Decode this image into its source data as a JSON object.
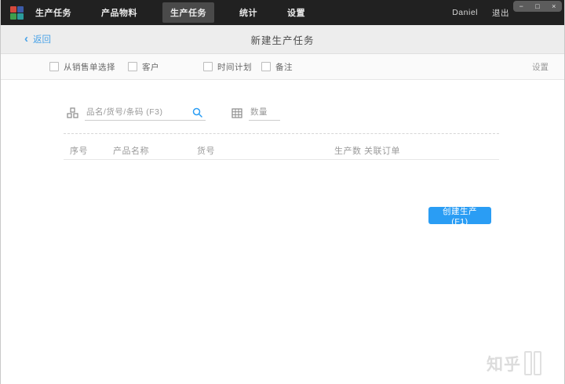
{
  "window": {
    "controls": {
      "minimize": "−",
      "maximize": "□",
      "close": "×"
    }
  },
  "titlebar": {
    "logo_colors": [
      "#d5493c",
      "#3c5ba8",
      "#3f9e4d",
      "#2b9c9c"
    ],
    "menu": [
      {
        "label": "生产任务"
      },
      {
        "label": "产品物料"
      },
      {
        "label": "生产任务"
      },
      {
        "label": "统计"
      },
      {
        "label": "设置"
      }
    ],
    "active_index": 2,
    "user": "Daniel",
    "logout": "退出"
  },
  "header": {
    "back_chevron": "‹",
    "back_label": "返回",
    "title": "新建生产任务"
  },
  "options_bar": {
    "checkboxes": [
      {
        "label": "从销售单选择",
        "checked": false
      },
      {
        "label": "客户",
        "checked": false
      },
      {
        "label": "时间计划",
        "checked": false
      },
      {
        "label": "备注",
        "checked": false
      }
    ],
    "settings_label": "设置"
  },
  "search_row": {
    "product_icon": "product-box-icon",
    "product_placeholder": "品名/货号/条码 (F3)",
    "search_icon": "magnifier-icon",
    "qty_icon": "grid-icon",
    "qty_placeholder": "数量"
  },
  "table": {
    "headers": [
      "序号",
      "产品名称",
      "货号",
      "生产数",
      "关联订单"
    ],
    "rows": []
  },
  "actions": {
    "create_button": "创建生产 (F1)"
  },
  "watermark": {
    "text": "知乎"
  },
  "colors": {
    "accent_blue": "#2a9df4",
    "link_blue": "#4aa3e8",
    "titlebar_bg": "#212121"
  }
}
